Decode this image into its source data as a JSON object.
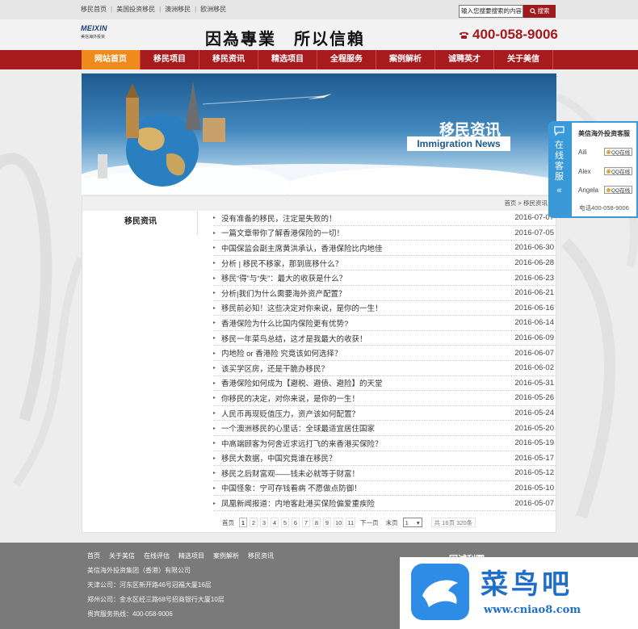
{
  "topbar": {
    "links": [
      "移民首页",
      "美国投资移民",
      "澳洲移民",
      "欧洲移民"
    ],
    "search_placeholder": "输入您搜要搜索的内容",
    "search_button": "搜索"
  },
  "header": {
    "logo_text": "MEIXIN",
    "logo_sub": "美信海外投资",
    "slogan": "因為專業　所以信賴",
    "hotline": "400-058-9006"
  },
  "nav": {
    "items": [
      "网站首页",
      "移民项目",
      "移民资讯",
      "精选项目",
      "全程服务",
      "案例解析",
      "诚聘英才",
      "关于美信"
    ],
    "active_index": 0
  },
  "banner": {
    "title": "移民资讯",
    "subtitle": "Immigration News"
  },
  "breadcrumb": "首页 > 移民资讯",
  "sidebar": {
    "title": "移民资讯"
  },
  "news": [
    {
      "title": "没有准备的移民，注定是失败的！",
      "date": "2016-07-07"
    },
    {
      "title": "一篇文章带你了解香港保险的一切！",
      "date": "2016-07-05"
    },
    {
      "title": "中国保监会副主席黄洪承认，香港保险比内地佳",
      "date": "2016-06-30"
    },
    {
      "title": "分析 | 移民不移家，那到底移什么？",
      "date": "2016-06-28"
    },
    {
      "title": "移民“得”与“失”：最大的收获是什么？",
      "date": "2016-06-23"
    },
    {
      "title": "分析|我们为什么需要海外资产配置？",
      "date": "2016-06-21"
    },
    {
      "title": "移民前必知！这些决定对你来说，是你的一生！",
      "date": "2016-06-16"
    },
    {
      "title": "香港保险为什么比国内保险更有优势?",
      "date": "2016-06-14"
    },
    {
      "title": "移民一年菜鸟总结，这才是我最大的收获！",
      "date": "2016-06-09"
    },
    {
      "title": "内地险 or 香港险 究竟该如何选择？",
      "date": "2016-06-07"
    },
    {
      "title": "该买学区房，还是干脆办移民？",
      "date": "2016-06-02"
    },
    {
      "title": "香港保险如何成为【避税、避债、避险】的天堂",
      "date": "2016-05-31"
    },
    {
      "title": "你移民的决定，对你来说，是你的一生！",
      "date": "2016-05-26"
    },
    {
      "title": "人民币再现贬值压力，资产该如何配置？",
      "date": "2016-05-24"
    },
    {
      "title": "一个澳洲移民的心里话：全球最适宜居住国家",
      "date": "2016-05-20"
    },
    {
      "title": "中高端顾客为何舍近求远打飞的来香港买保险？",
      "date": "2016-05-19"
    },
    {
      "title": "移民大数据，中国究竟谁在移民？",
      "date": "2016-05-17"
    },
    {
      "title": "移民之后财富观——钱未必就等于财富！",
      "date": "2016-05-12"
    },
    {
      "title": "中国怪象：宁可存钱看病 不愿做点防御！",
      "date": "2016-05-10"
    },
    {
      "title": "凤凰新闻报道：内地客赴港买保险偏爱重疾险",
      "date": "2016-05-07"
    }
  ],
  "pager": {
    "first": "首页",
    "pages": [
      "1",
      "2",
      "3",
      "4",
      "5",
      "6",
      "7",
      "8",
      "9",
      "10",
      "11"
    ],
    "current": "1",
    "next": "下一页",
    "last": "末页",
    "select_value": "1",
    "total": "共 16页 320条"
  },
  "footer": {
    "links": [
      "首页",
      "关于美信",
      "在线评估",
      "精选项目",
      "案例解析",
      "移民资讯"
    ],
    "company": "美信海外投资集团（香港）有限公司",
    "tianjin": "天津公司：河东区新开路46号冠福大厦16层",
    "zhengzhou": "郑州公司：金水区经三路68号招商银行大厦10层",
    "service": "贵宾服务热线：400-058-9006",
    "qr_label": "回诚利圆"
  },
  "watermark": {
    "cn": "菜鸟吧",
    "url": "www.cniao8.com"
  },
  "qq": {
    "tab_label": [
      "在",
      "线",
      "客",
      "服"
    ],
    "heading": "美信海外投资客服",
    "agents": [
      "Aili",
      "Alex",
      "Angela"
    ],
    "badge": "QQ在线",
    "tel": "电话400-058-9006"
  },
  "colors": {
    "brand_red": "#a71b1f",
    "nav_active": "#ef8a1c",
    "qq_blue": "#3a9ad9"
  }
}
